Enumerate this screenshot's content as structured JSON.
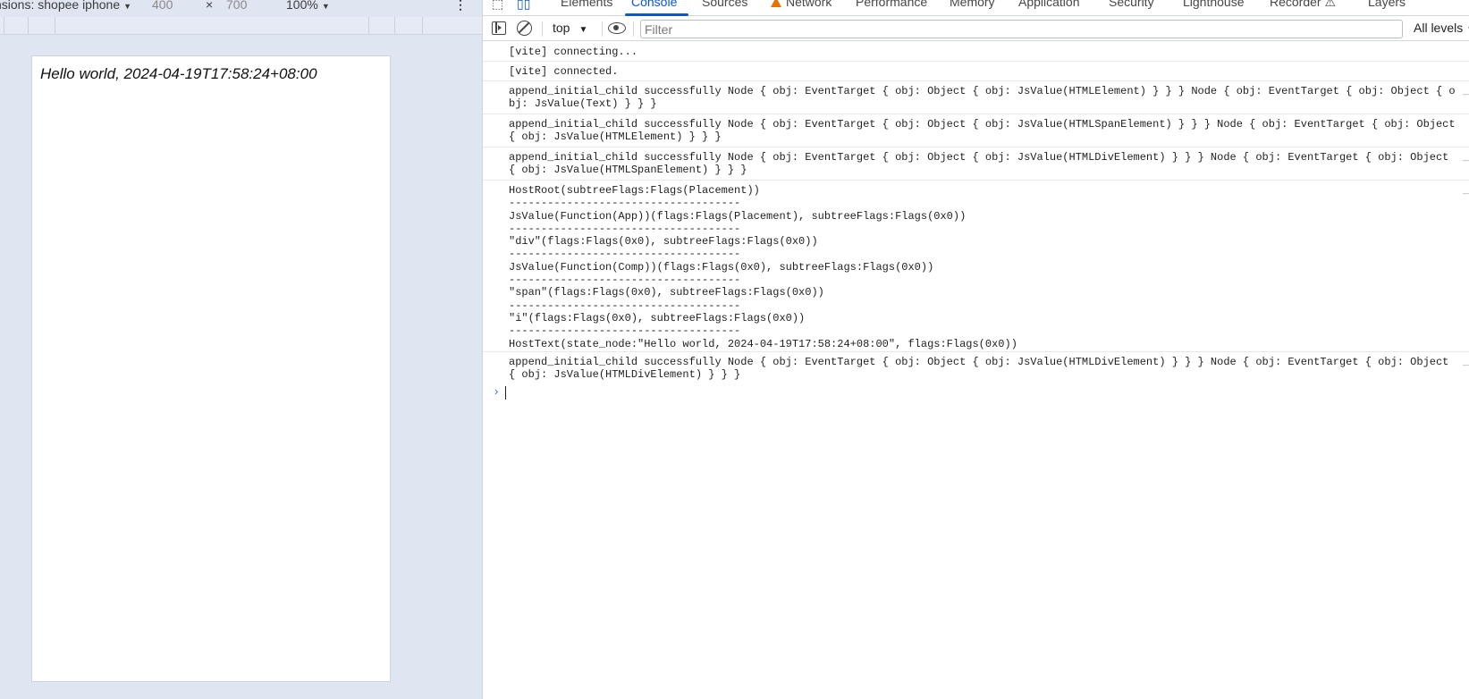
{
  "device_toolbar": {
    "dimensions_label": "nsions: shopee iphone",
    "width": "400",
    "height": "700",
    "times": "×",
    "zoom": "100%",
    "menu": "⋮"
  },
  "viewport": {
    "text": "Hello world, 2024-04-19T17:58:24+08:00"
  },
  "devtools": {
    "tabs": [
      {
        "label": "Elements"
      },
      {
        "label": "Console"
      },
      {
        "label": "Sources"
      },
      {
        "label": "Network"
      },
      {
        "label": "Performance"
      },
      {
        "label": "Memory"
      },
      {
        "label": "Application"
      },
      {
        "label": "Security"
      },
      {
        "label": "Lighthouse"
      },
      {
        "label": "Recorder"
      },
      {
        "label": "Layers"
      }
    ],
    "active_tab": "Console",
    "accent_color": "#0b57d0",
    "warning_color": "#e37400"
  },
  "console_toolbar": {
    "context": "top",
    "filter_placeholder": "Filter",
    "levels": "All levels"
  },
  "console": {
    "messages": [
      {
        "text": "[vite] connecting..."
      },
      {
        "text": "[vite] connected."
      },
      {
        "text": "append_initial_child successfully Node { obj: EventTarget { obj: Object { obj: JsValue(HTMLElement) } } } Node { obj: EventTarget { obj: Object { obj: JsValue(Text) } } }"
      },
      {
        "text": "append_initial_child successfully Node { obj: EventTarget { obj: Object { obj: JsValue(HTMLSpanElement) } } } Node { obj: EventTarget { obj: Object { obj: JsValue(HTMLElement) } } }"
      },
      {
        "text": "append_initial_child successfully Node { obj: EventTarget { obj: Object { obj: JsValue(HTMLDivElement) } } } Node { obj: EventTarget { obj: Object { obj: JsValue(HTMLSpanElement) } } }"
      },
      {
        "text": "HostRoot(subtreeFlags:Flags(Placement))\n------------------------------------\nJsValue(Function(App))(flags:Flags(Placement), subtreeFlags:Flags(0x0))\n------------------------------------\n\"div\"(flags:Flags(0x0), subtreeFlags:Flags(0x0))\n------------------------------------\nJsValue(Function(Comp))(flags:Flags(0x0), subtreeFlags:Flags(0x0))\n------------------------------------\n\"span\"(flags:Flags(0x0), subtreeFlags:Flags(0x0))\n------------------------------------\n\"i\"(flags:Flags(0x0), subtreeFlags:Flags(0x0))\n------------------------------------\nHostText(state_node:\"Hello world, 2024-04-19T17:58:24+08:00\", flags:Flags(0x0))"
      },
      {
        "text": "append_initial_child successfully Node { obj: EventTarget { obj: Object { obj: JsValue(HTMLDivElement) } } } Node { obj: EventTarget { obj: Object { obj: JsValue(HTMLDivElement) } } }"
      }
    ]
  }
}
